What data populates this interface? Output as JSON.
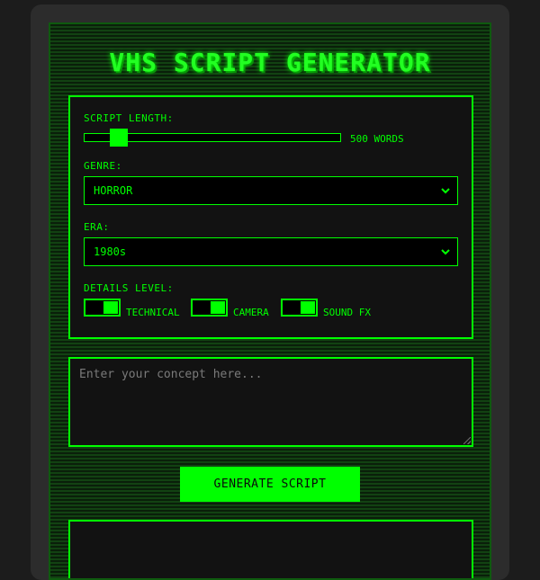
{
  "app": {
    "title": "VHS SCRIPT GENERATOR"
  },
  "settings": {
    "length": {
      "label": "SCRIPT LENGTH:",
      "value_text": "500 WORDS",
      "position_fraction": 0.11
    },
    "genre": {
      "label": "GENRE:",
      "selected": "HORROR"
    },
    "era": {
      "label": "ERA:",
      "selected": "1980s"
    },
    "details": {
      "label": "DETAILS LEVEL:",
      "toggles": [
        {
          "label": "TECHNICAL",
          "on": true
        },
        {
          "label": "CAMERA",
          "on": true
        },
        {
          "label": "SOUND FX",
          "on": true
        }
      ]
    }
  },
  "concept": {
    "placeholder": "Enter your concept here..."
  },
  "actions": {
    "generate_label": "GENERATE SCRIPT"
  },
  "colors": {
    "accent": "#00ff00",
    "panel": "#121212",
    "screen": "#0b2a0b",
    "bezel": "#2c2c2c"
  },
  "icons": {
    "dropdown": "chevron-down-icon"
  }
}
